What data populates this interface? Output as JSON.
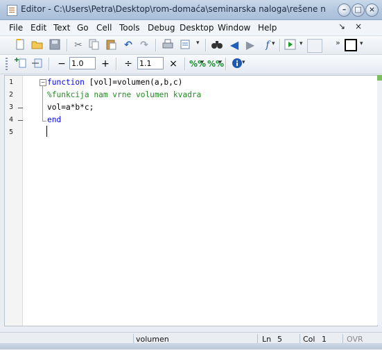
{
  "titlebar": {
    "text": "Editor - C:\\Users\\Petra\\Desktop\\rom-domaća\\seminarska naloga\\rešene naloge\\nal..."
  },
  "window_buttons": {
    "minimize": "–",
    "maximize": "□",
    "close": "×"
  },
  "menu": {
    "items": [
      "File",
      "Edit",
      "Text",
      "Go",
      "Cell",
      "Tools",
      "Debug",
      "Desktop",
      "Window",
      "Help"
    ],
    "right": [
      "↘",
      "×"
    ]
  },
  "toolbar2": {
    "minus": "−",
    "value1": "1.0",
    "plus": "+",
    "divide": "÷",
    "value2": "1.1",
    "times": "×"
  },
  "editor": {
    "line_numbers": [
      "1",
      "2",
      "3",
      "4",
      "5"
    ],
    "lines": [
      {
        "keyword": "function",
        "rest": " [vol]=volumen(a,b,c)"
      },
      {
        "comment": "%funkcija nam vrne volumen kvadra"
      },
      {
        "text": "vol=a*b*c;"
      },
      {
        "keyword": "end"
      },
      {
        "text": ""
      }
    ]
  },
  "status": {
    "function_name": "volumen",
    "ln_label": "Ln",
    "ln_value": "5",
    "col_label": "Col",
    "col_value": "1",
    "mode": "OVR"
  }
}
